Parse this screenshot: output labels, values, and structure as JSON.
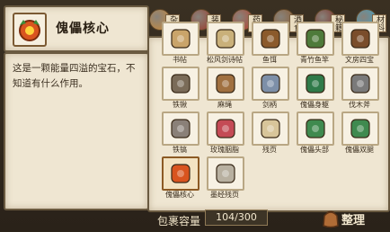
{
  "selected_item": {
    "name": "傀儡核心",
    "description": "这是一颗能量四溢的宝石，不知道有什么作用。"
  },
  "tabs": [
    {
      "label": "杂",
      "icon": "misc-tab-icon",
      "color": "#c98a3a"
    },
    {
      "label": "装备",
      "icon": "equipment-tab-icon",
      "color": "#9a3b2b"
    },
    {
      "label": "药品",
      "icon": "potion-tab-icon",
      "color": "#b5432f"
    },
    {
      "label": "酒食",
      "icon": "food-tab-icon",
      "color": "#8d5a2c"
    },
    {
      "label": "秘籍",
      "icon": "book-tab-icon",
      "color": "#7d2a22"
    },
    {
      "label": "材料",
      "icon": "material-tab-icon",
      "color": "#3aa4c9"
    }
  ],
  "items": [
    {
      "name": "书帖"
    },
    {
      "name": "松风剑诗帖"
    },
    {
      "name": "鱼饵"
    },
    {
      "name": "青竹鱼竿"
    },
    {
      "name": "文房四宝"
    },
    {
      "name": "铁锹"
    },
    {
      "name": "麻绳"
    },
    {
      "name": "剑柄"
    },
    {
      "name": "傀儡身躯"
    },
    {
      "name": "伐木斧"
    },
    {
      "name": "铁镐"
    },
    {
      "name": "玫瑰胭脂"
    },
    {
      "name": "残页"
    },
    {
      "name": "傀儡头部"
    },
    {
      "name": "傀儡双腿"
    },
    {
      "name": "傀儡核心"
    },
    {
      "name": "墨经残页"
    }
  ],
  "footer": {
    "capacity_label": "包裹容量",
    "capacity_value": "104/300",
    "sort_label": "整理"
  }
}
